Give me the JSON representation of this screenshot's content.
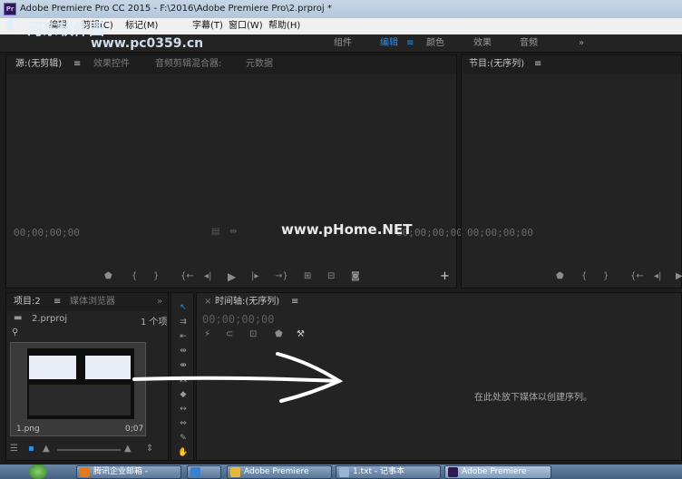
{
  "window": {
    "title": "Adobe Premiere Pro CC 2015 - F:\\2016\\Adobe Premiere Pro\\2.prproj *"
  },
  "menu": {
    "items": [
      "编辑",
      "剪辑(C)",
      "标记(M)",
      "字幕(T)",
      "窗口(W)",
      "帮助(H)"
    ]
  },
  "workspaces": {
    "items": [
      "组件",
      "编辑",
      "颜色",
      "效果",
      "音频"
    ],
    "active": "编辑",
    "more": "»"
  },
  "source_panel": {
    "tabs": [
      "源:(无剪辑)",
      "效果控件",
      "音频剪辑混合器:",
      "元数据"
    ],
    "menu_glyph": "≡",
    "timecode_left": "00;00;00;00",
    "timecode_right": "00;00;00;00"
  },
  "program_panel": {
    "tab": "节目:(无序列)",
    "menu_glyph": "≡",
    "timecode_left": "00;00;00;00"
  },
  "project_panel": {
    "tabs": [
      "项目:2",
      "媒体浏览器"
    ],
    "menu_glyph": "≡",
    "more": "»",
    "file_name": "2.prproj",
    "item_count": "1 个项",
    "clip_name": "1.png",
    "clip_duration": "0;07"
  },
  "timeline_panel": {
    "close": "×",
    "tab": "时间轴:(无序列)",
    "menu_glyph": "≡",
    "timecode": "00;00;00;00",
    "drop_hint": "在此处放下媒体以创建序列。"
  },
  "watermarks": {
    "site_name": "河东软件园",
    "site_url": "www.pc0359.cn",
    "other_url": "www.pHome.NET"
  },
  "taskbar": {
    "items": [
      "腾讯企业邮箱 -",
      "",
      "Adobe Premiere",
      "1.txt - 记事本",
      "Adobe Premiere"
    ],
    "colors": [
      "#e07a1f",
      "#3a7fd0",
      "#e6b73a",
      "#9ab5d4",
      "#2b1b52"
    ]
  },
  "colors": {
    "accent": "#2f8de4",
    "panel_bg": "#232323",
    "frame_bg": "#1c1c1c"
  }
}
